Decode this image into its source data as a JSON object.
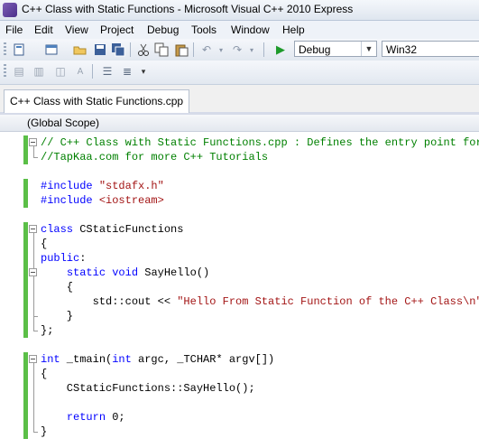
{
  "window": {
    "title": "C++ Class with Static Functions - Microsoft Visual C++ 2010 Express"
  },
  "menu": [
    "File",
    "Edit",
    "View",
    "Project",
    "Debug",
    "Tools",
    "Window",
    "Help"
  ],
  "toolbar": {
    "config": "Debug",
    "platform": "Win32",
    "icons": [
      "new-project-icon",
      "add-item-icon",
      "open-file-icon",
      "save-icon",
      "save-all-icon",
      "cut-icon",
      "copy-icon",
      "paste-icon",
      "undo-icon",
      "redo-icon",
      "start-debugging-icon"
    ]
  },
  "editor": {
    "tab": "C++ Class with Static Functions.cpp",
    "scope": "(Global Scope)",
    "lines": [
      "// C++ Class with Static Functions.cpp : Defines the entry point for t",
      "//TapKaa.com for more C++ Tutorials",
      "",
      "#include \"stdafx.h\"",
      "#include <iostream>",
      "",
      "class CStaticFunctions",
      "{",
      "public:",
      "    static void SayHello()",
      "    {",
      "        std::cout << \"Hello From Static Function of the C++ Class\\n\";",
      "    }",
      "};",
      "",
      "int _tmain(int argc, _TCHAR* argv[])",
      "{",
      "    CStaticFunctions::SayHello();",
      "",
      "    return 0;",
      "}"
    ]
  },
  "colors": {
    "comment": "#008000",
    "keyword": "#0000ff",
    "string": "#a31515",
    "changed": "#5bbf47"
  }
}
